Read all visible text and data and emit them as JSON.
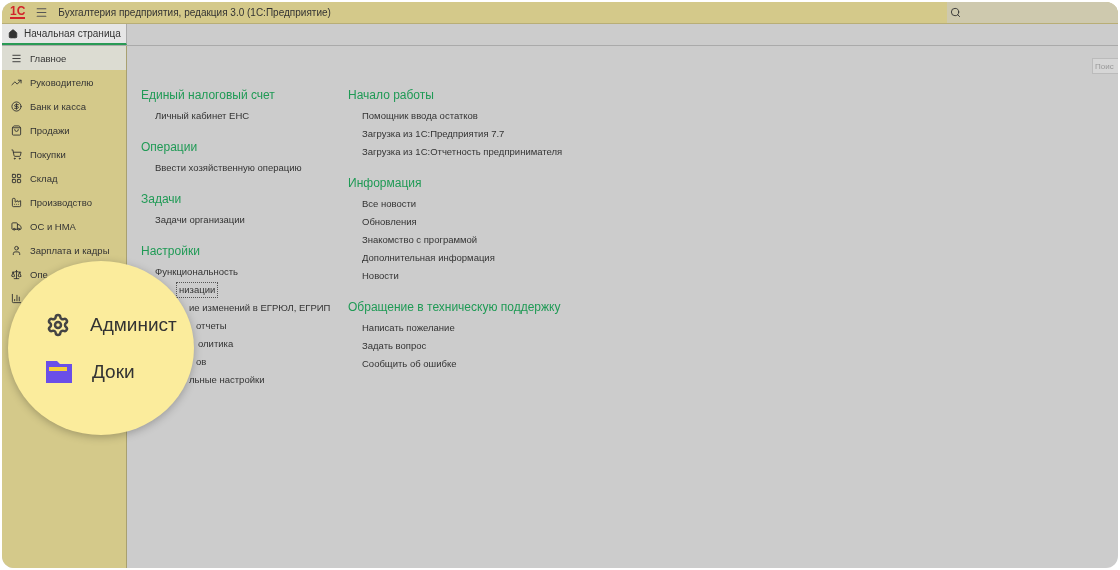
{
  "window": {
    "logo": "1С",
    "title": "Бухгалтерия предприятия, редакция 3.0  (1С:Предприятие)"
  },
  "tabs": [
    {
      "label": "Начальная страница",
      "selected": true
    }
  ],
  "sidebar": {
    "items": [
      {
        "label": "Главное",
        "selected": true
      },
      {
        "label": "Руководителю",
        "selected": false
      },
      {
        "label": "Банк и касса",
        "selected": false
      },
      {
        "label": "Продажи",
        "selected": false
      },
      {
        "label": "Покупки",
        "selected": false
      },
      {
        "label": "Склад",
        "selected": false
      },
      {
        "label": "Производство",
        "selected": false
      },
      {
        "label": "ОС и НМА",
        "selected": false
      },
      {
        "label": "Зарплата и кадры",
        "selected": false
      },
      {
        "label": "Опе",
        "selected": false
      },
      {
        "selected": false
      }
    ]
  },
  "search": {
    "placeholder": "Поис"
  },
  "columns": [
    [
      {
        "title": "Единый налоговый счет",
        "items": [
          {
            "label": "Личный кабинет ЕНС"
          }
        ]
      },
      {
        "title": "Операции",
        "items": [
          {
            "label": "Ввести хозяйственную операцию"
          }
        ]
      },
      {
        "title": "Задачи",
        "items": [
          {
            "label": "Задачи организации"
          }
        ]
      },
      {
        "title": "Настройки",
        "items": [
          {
            "label": "Функциональность"
          },
          {
            "label": "низации",
            "focused": true
          },
          {
            "label": "ие изменений в ЕГРЮЛ, ЕГРИП"
          },
          {
            "label": "отчеты"
          },
          {
            "label": "олитика"
          },
          {
            "label": "ов"
          },
          {
            "label": "льные настройки"
          }
        ]
      }
    ],
    [
      {
        "title": "Начало работы",
        "items": [
          {
            "label": "Помощник ввода остатков"
          },
          {
            "label": "Загрузка из 1С:Предприятия 7.7"
          },
          {
            "label": "Загрузка из 1С:Отчетность предпринимателя"
          }
        ]
      },
      {
        "title": "Информация",
        "items": [
          {
            "label": "Все новости"
          },
          {
            "label": "Обновления"
          },
          {
            "label": "Знакомство с программой"
          },
          {
            "label": "Дополнительная информация"
          },
          {
            "label": "Новости"
          }
        ]
      },
      {
        "title": "Обращение в техническую поддержку",
        "items": [
          {
            "label": "Написать пожелание"
          },
          {
            "label": "Задать вопрос"
          },
          {
            "label": "Сообщить об ошибке"
          }
        ]
      }
    ]
  ],
  "magnifier": {
    "items": [
      {
        "label": "Админист"
      },
      {
        "label": "Доки"
      }
    ]
  }
}
